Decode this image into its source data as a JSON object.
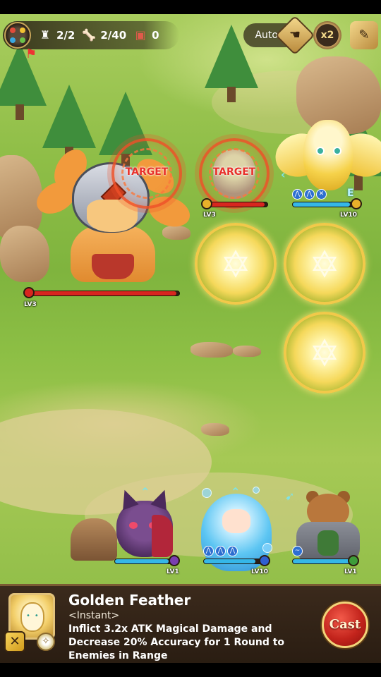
{
  "hud": {
    "stage_progress": "2/2",
    "kill_count": "2/40",
    "chest_count": "0",
    "auto_label": "Auto",
    "speed_label": "x2"
  },
  "icons": {
    "menu": "menu-orb-icon",
    "stage": "castle-icon",
    "kills": "bone-icon",
    "chest": "chest-icon",
    "auto": "hand-pointer-icon",
    "speed": "speed-icon",
    "log": "notebook-icon",
    "flag": "flag-icon"
  },
  "battlefield": {
    "boss": {
      "level": "LV3",
      "hp_fraction": 0.98
    },
    "enemy_2": {
      "level": "LV3",
      "hp_fraction": 0.95,
      "target_label": "TARGET"
    },
    "enemy_1_target_label": "TARGET",
    "owl": {
      "level": "LV10",
      "hp_fraction": 0.9,
      "marker": "E"
    },
    "cat": {
      "level": "LV1",
      "hp_fraction": 0.9
    },
    "mage": {
      "level": "LV10",
      "hp_fraction": 0.85
    },
    "bear": {
      "level": "LV1",
      "hp_fraction": 0.95
    }
  },
  "skill": {
    "name": "Golden Feather",
    "type": "<Instant>",
    "description": "Inflict 3.2x ATK Magical Damage and Decrease 20% Accuracy for 1 Round to Enemies in Range",
    "cast_label": "Cast"
  },
  "colors": {
    "hp_enemy": "#d8261f",
    "hp_ally": "#35b7e8",
    "accent_gold": "#f2c94a",
    "cast_red": "#c3241c"
  }
}
